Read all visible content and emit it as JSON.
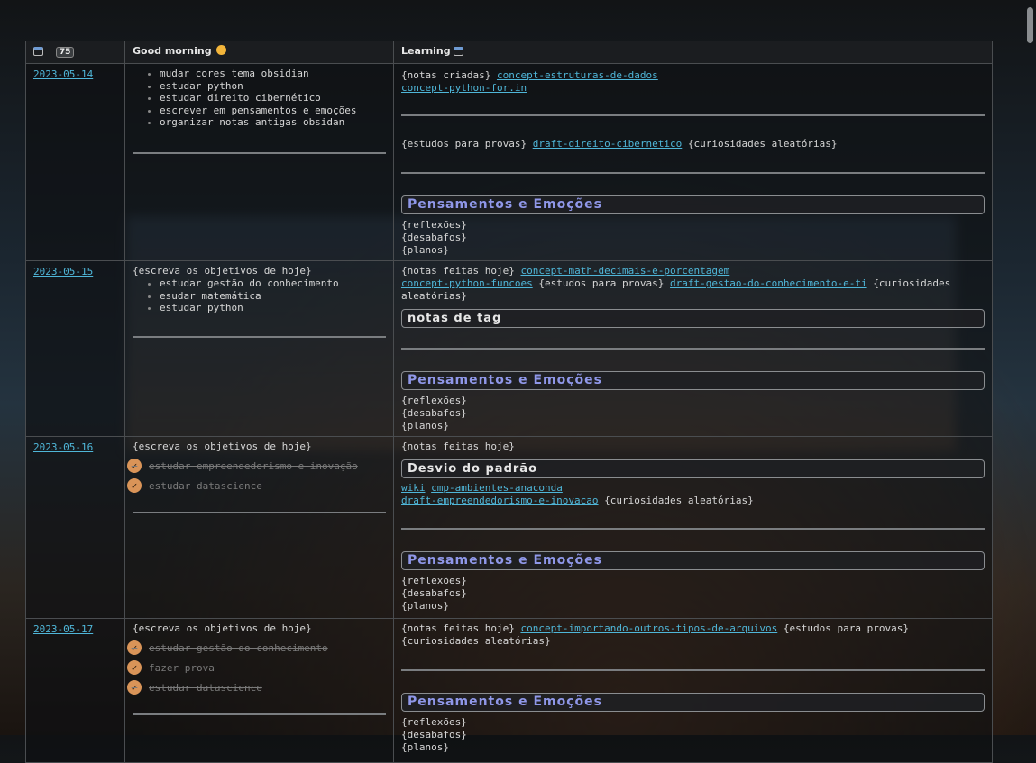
{
  "header": {
    "col1_badge": "75",
    "col2_title": "Good morning",
    "col3_title": "Learning"
  },
  "rows": [
    {
      "date": "2023-05-14",
      "morning_items": [
        "mudar cores tema obsidian",
        "estudar python",
        "estudar direito cibernético",
        "escrever em pensamentos e emoções",
        "organizar notas antigas obsidan"
      ],
      "learn": {
        "notas_label": "{notas criadas}",
        "notas_link1": "concept-estruturas-de-dados",
        "notas_link2": "concept-python-for.in",
        "estudos_label": "{estudos para provas}",
        "estudos_link": "draft-direito-cibernetico",
        "curio_label": "{curiosidades aleatórias}"
      }
    },
    {
      "date": "2023-05-15",
      "objetivos_label": "{escreva os objetivos de hoje}",
      "morning_items": [
        "estudar gestão do conhecimento",
        "esudar matemática",
        "estudar python"
      ],
      "learn": {
        "notas_label": "{notas feitas hoje}",
        "notas_link1": "concept-math-decimais-e-porcentagem",
        "notas_link2": "concept-python-funcoes",
        "estudos_label": "{estudos para provas}",
        "estudos_link": "draft-gestao-do-conhecimento-e-ti",
        "curio_label": "{curiosidades aleatórias}",
        "tag_callout": "notas de tag"
      }
    },
    {
      "date": "2023-05-16",
      "objetivos_label": "{escreva os objetivos de hoje}",
      "tasks": [
        "estudar empreendedorismo e inovação",
        "estudar datascience"
      ],
      "learn": {
        "notas_label": "{notas feitas hoje}",
        "desvio_callout": "Desvio do padrão",
        "link_wiki": "wiki",
        "link_cmp": "cmp-ambientes-anaconda",
        "link_draft": "draft-empreendedorismo-e-inovacao",
        "curio_label": "{curiosidades aleatórias}"
      }
    },
    {
      "date": "2023-05-17",
      "objetivos_label": "{escreva os objetivos de hoje}",
      "tasks": [
        "estudar gestão do conhecimento",
        "fazer prova",
        "estudar datascience"
      ],
      "learn": {
        "notas_label": "{notas feitas hoje}",
        "notas_link1": "concept-importando-outros-tipos-de-arquivos",
        "estudos_label": "{estudos para provas}",
        "curio_label": "{curiosidades aleatórias}"
      }
    }
  ],
  "pensamentos": {
    "title": "Pensamentos e Emoções",
    "reflexoes": "{reflexões}",
    "desabafos": "{desabafos}",
    "planos": "{planos}"
  },
  "colors": {
    "link": "#4fb6d8",
    "callout_purple": "#8f97e8",
    "check": "#d99458"
  },
  "icons": {
    "header_col1": "calendar-icon",
    "header_col3": "calendar-icon",
    "header_col2": "smiley-emoji-icon",
    "task_done": "check-circle-icon"
  }
}
